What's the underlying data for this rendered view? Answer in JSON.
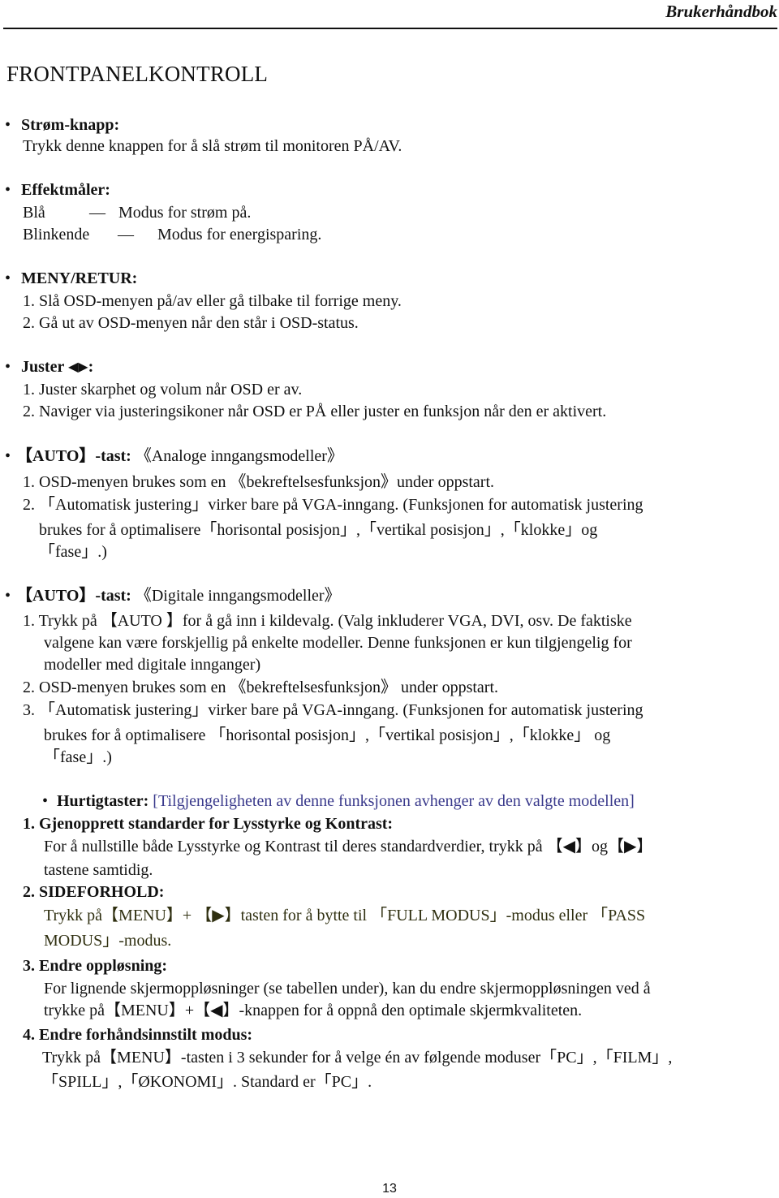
{
  "header": {
    "title": "Brukerhåndbok"
  },
  "page_title": "FRONTPANELKONTROLL",
  "sections": {
    "power_button": {
      "heading": "Strøm-knapp:",
      "text": "Trykk denne knappen for å slå strøm til monitoren PÅ/AV."
    },
    "power_meter": {
      "heading": "Effektmåler:",
      "rows": [
        {
          "label": "Blå",
          "dash": "—",
          "desc": "Modus for strøm på."
        },
        {
          "label": "Blinkende",
          "dash": "—",
          "desc": "Modus for energisparing."
        }
      ]
    },
    "menu_return": {
      "heading": "MENY/RETUR:",
      "items": [
        "1. Slå OSD-menyen på/av eller gå tilbake til forrige meny.",
        "2. Gå ut av OSD-menyen når den står i OSD-status."
      ]
    },
    "adjust": {
      "heading": "Juster",
      "heading_suffix": ":",
      "left_icon": "◀",
      "right_icon": "▶",
      "items": [
        "1. Juster skarphet og volum når OSD er av.",
        "2. Naviger via justeringsikoner når OSD er PÅ eller juster en funksjon når den er aktivert."
      ]
    },
    "auto_analog": {
      "heading": "【AUTO】-tast:",
      "subheading": "《Analoge inngangsmodeller》",
      "lines": [
        "1. OSD-menyen brukes som en 《bekreftelsesfunksjon》under oppstart.",
        "2. 「Automatisk justering」virker bare på VGA-inngang. (Funksjonen for automatisk justering",
        "brukes for å optimalisere「horisontal   posisjon」,「vertikal posisjon」,「klokke」og",
        "「fase」.)"
      ]
    },
    "auto_digital": {
      "heading": "【AUTO】-tast:",
      "subheading": "《Digitale inngangsmodeller》",
      "lines": [
        "1. Trykk på 【AUTO 】for å gå inn i kildevalg. (Valg inkluderer VGA, DVI, osv. De faktiske",
        "valgene kan være forskjellig på enkelte modeller. Denne funksjonen er kun tilgjengelig for",
        "modeller med digitale innganger)",
        "2. OSD-menyen brukes som en 《bekreftelsesfunksjon》 under oppstart.",
        "3. 「Automatisk justering」virker bare på VGA-inngang. (Funksjonen for automatisk justering",
        "brukes for å optimalisere 「horisontal   posisjon」,「vertikal posisjon」,「klokke」 og",
        "「fase」.)"
      ]
    },
    "hotkeys": {
      "heading": "Hurtigtaster:",
      "note": "[Tilgjengeligheten av denne funksjonen avhenger av den valgte modellen]",
      "note_color": "#3a3a8c",
      "items": [
        {
          "title": "1. Gjenopprett standarder for Lysstyrke og Kontrast:",
          "lines": [
            "For å nullstille både Lysstyrke og Kontrast til deres standardverdier, trykk på  【◀】og【▶】",
            "tastene samtidig."
          ]
        },
        {
          "title": "2. SIDEFORHOLD:",
          "lines": [
            "Trykk på【MENU】+ 【▶】tasten for å bytte til 「FULL MODUS」-modus eller 「PASS",
            "MODUS」-modus."
          ],
          "text_color": "#2f2f10"
        },
        {
          "title": "3. Endre oppløsning:",
          "lines": [
            "For lignende skjermoppløsninger (se tabellen under), kan du endre skjermoppløsningen ved å",
            "trykke på【MENU】+【◀】-knappen for å oppnå den optimale skjermkvaliteten."
          ]
        },
        {
          "title": "4. Endre forhåndsinnstilt modus:",
          "lines": [
            "Trykk på【MENU】-tasten i 3 sekunder for å velge én av følgende moduser「PC」,「FILM」,",
            "「SPILL」,「ØKONOMI」. Standard er「PC」."
          ]
        }
      ]
    }
  },
  "page_number": "13"
}
